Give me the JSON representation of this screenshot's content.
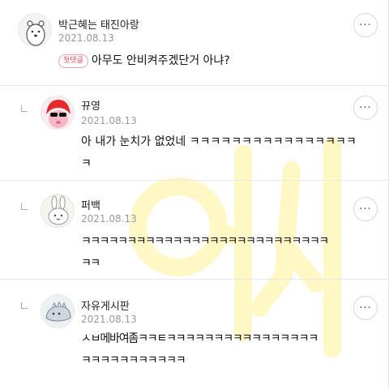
{
  "comments": [
    {
      "author": "박근혜는 태진아랑",
      "date": "2021.08.13",
      "badge": "첫댓글",
      "body": "아무도 안비켜주겠단거 아냐?",
      "is_reply": false
    },
    {
      "author": "뀨영",
      "date": "2021.08.13",
      "lines": [
        "아 내가 눈치가 없었네 ㅋㅋㅋㅋㅋㅋㅋㅋㅋㅋㅋㅋㅋㅋㅋㅋ",
        "ㅋ"
      ],
      "is_reply": true
    },
    {
      "author": "퍼백",
      "date": "2021.08.13",
      "lines": [
        "ㅋㅋㅋㅋㅋㅋㅋㅋㅋㅋㅋㅋㅋㅋㅋㅋㅋㅋㅋㅋㅋㅋㅋㅋㅋㅋㅋ",
        "ㅋㅋ"
      ],
      "is_reply": true
    },
    {
      "author": "자유게시판",
      "date": "2021.08.13",
      "lines": [
        "ㅅㅂ메바여좀ㅋㅋㅌㅋㅋㅋㅋㅋㅋㅋㅋㅋㅋㅋㅋㅋㅋㅋㅋ",
        "ㅋㅋㅋㅋㅋㅋㅋㅋㅋㅋㅋ"
      ],
      "is_reply": true
    }
  ],
  "more_label": "···",
  "icons": [
    "avatar-bear",
    "avatar-red-hair",
    "avatar-bunny",
    "avatar-blob",
    "more-icon",
    "reply-indicator-icon"
  ],
  "colors": {
    "badge": "#e84a5f",
    "date": "#9a9a9a",
    "watermark": "#fff6b8"
  }
}
